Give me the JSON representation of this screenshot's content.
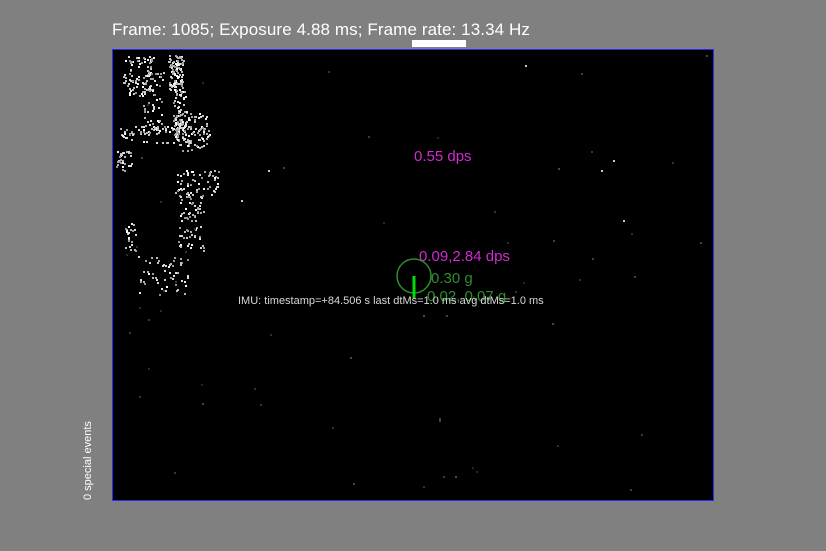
{
  "header": {
    "status_text": "Frame: 1085; Exposure 4.88 ms; Frame rate: 13.34 Hz"
  },
  "overlay": {
    "rotation_rate_label": "0.55 dps",
    "pan_tilt_rate_label": "0.09,2.84 dps",
    "accel_magnitude_label": "0.30 g",
    "accel_vector_label": "0.02, 0.07 g",
    "imu_status_text": "IMU: timestamp=+84.506  s last dtMs=1.0   ms  avg dtMs=1.0   ms"
  },
  "footer": {
    "special_events_text": "0 special events"
  },
  "colors": {
    "background": "#808080",
    "canvas": "#000000",
    "canvas_border": "#2a2aff",
    "gyro_text": "#d02bd0",
    "accel_text": "#2d8e2d",
    "accel_indicator": "#00dd00"
  }
}
